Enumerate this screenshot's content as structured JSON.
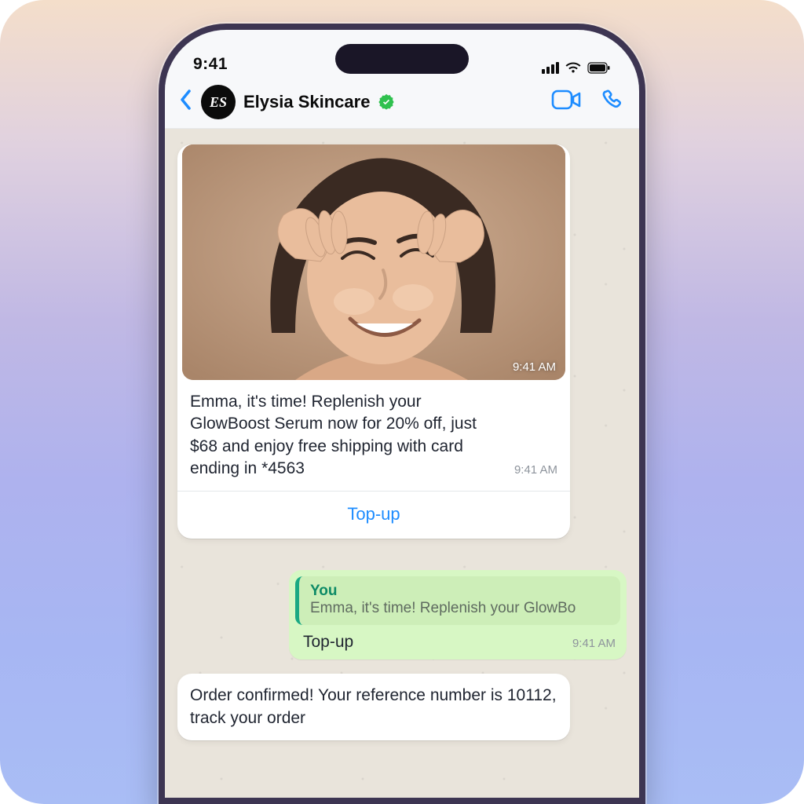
{
  "statusbar": {
    "time": "9:41"
  },
  "header": {
    "contact_name": "Elysia Skincare",
    "avatar_text": "ES"
  },
  "messages": {
    "promo": {
      "image_timestamp": "9:41 AM",
      "body": "Emma, it's time! Replenish your GlowBoost Serum now for 20% off, just $68 and enjoy free shipping with card ending in *4563",
      "timestamp": "9:41 AM",
      "cta_label": "Top-up"
    },
    "reply": {
      "quote_author": "You",
      "quote_preview": "Emma, it's time! Replenish your GlowBo",
      "body": "Top-up",
      "timestamp": "9:41 AM"
    },
    "confirm": {
      "body": "Order confirmed! Your reference number is 10112, track your order"
    }
  }
}
